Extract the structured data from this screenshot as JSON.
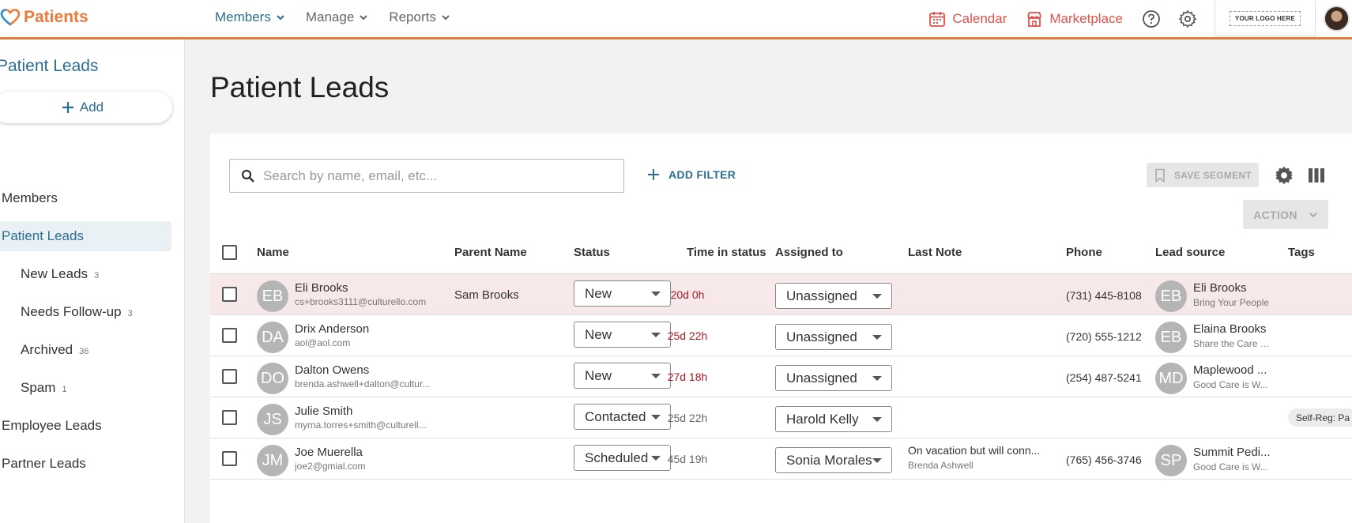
{
  "brand": {
    "name": "Patients"
  },
  "nav": {
    "items": [
      {
        "label": "Members",
        "active": true
      },
      {
        "label": "Manage",
        "active": false
      },
      {
        "label": "Reports",
        "active": false
      }
    ],
    "calendar": "Calendar",
    "marketplace": "Marketplace",
    "logo_text": "YOUR LOGO HERE"
  },
  "sidebar": {
    "title": "Patient Leads",
    "add_label": "Add",
    "items": [
      {
        "label": "Members",
        "count": ""
      },
      {
        "label": "Patient Leads",
        "count": ""
      },
      {
        "label": "New Leads",
        "count": "3"
      },
      {
        "label": "Needs Follow-up",
        "count": "3"
      },
      {
        "label": "Archived",
        "count": "36"
      },
      {
        "label": "Spam",
        "count": "1"
      },
      {
        "label": "Employee Leads",
        "count": ""
      },
      {
        "label": "Partner Leads",
        "count": ""
      }
    ]
  },
  "main": {
    "title": "Patient Leads",
    "search_placeholder": "Search by name, email, etc...",
    "add_filter": "ADD FILTER",
    "save_segment": "SAVE SEGMENT",
    "action": "ACTION"
  },
  "table": {
    "columns": [
      "Name",
      "Parent Name",
      "Status",
      "Time in status",
      "Assigned to",
      "Last Note",
      "Phone",
      "Lead source",
      "Tags"
    ],
    "rows": [
      {
        "initials": "EB",
        "name": "Eli Brooks",
        "email": "cs+brooks3111@culturello.com",
        "parent": "Sam Brooks",
        "status": "New",
        "time": "20d 0h",
        "assigned": "Unassigned",
        "note": "",
        "note_by": "",
        "phone": "(731) 445-8108",
        "src_initials": "EB",
        "src_name": "Eli Brooks",
        "src_sub": "Bring Your People",
        "tag": ""
      },
      {
        "initials": "DA",
        "name": "Drix Anderson",
        "email": "aol@aol.com",
        "parent": "",
        "status": "New",
        "time": "25d 22h",
        "assigned": "Unassigned",
        "note": "",
        "note_by": "",
        "phone": "(720) 555-1212",
        "src_initials": "EB",
        "src_name": "Elaina Brooks",
        "src_sub": "Share the Care (...",
        "tag": ""
      },
      {
        "initials": "DO",
        "name": "Dalton Owens",
        "email": "brenda.ashwell+dalton@cultur...",
        "parent": "",
        "status": "New",
        "time": "27d 18h",
        "assigned": "Unassigned",
        "note": "",
        "note_by": "",
        "phone": "(254) 487-5241",
        "src_initials": "MD",
        "src_name": "Maplewood ...",
        "src_sub": "Good Care is W...",
        "tag": ""
      },
      {
        "initials": "JS",
        "name": "Julie Smith",
        "email": "myrna.torres+smith@culturell...",
        "parent": "",
        "status": "Contacted",
        "time": "25d 22h",
        "assigned": "Harold Kelly",
        "note": "",
        "note_by": "",
        "phone": "",
        "src_initials": "",
        "src_name": "",
        "src_sub": "",
        "tag": "Self-Reg: Pa"
      },
      {
        "initials": "JM",
        "name": "Joe Muerella",
        "email": "joe2@gmial.com",
        "parent": "",
        "status": "Scheduled",
        "time": "45d 19h",
        "assigned": "Sonia Morales",
        "note": "On vacation but will conn...",
        "note_by": "Brenda Ashwell",
        "phone": "(765) 456-3746",
        "src_initials": "SP",
        "src_name": "Summit Pedi...",
        "src_sub": "Good Care is W...",
        "tag": ""
      }
    ]
  },
  "colors": {
    "accent": "#2b6e8f",
    "brand": "#ea7a3a",
    "alert": "#a31d2b",
    "highlight_row": "#f7e8ea"
  }
}
